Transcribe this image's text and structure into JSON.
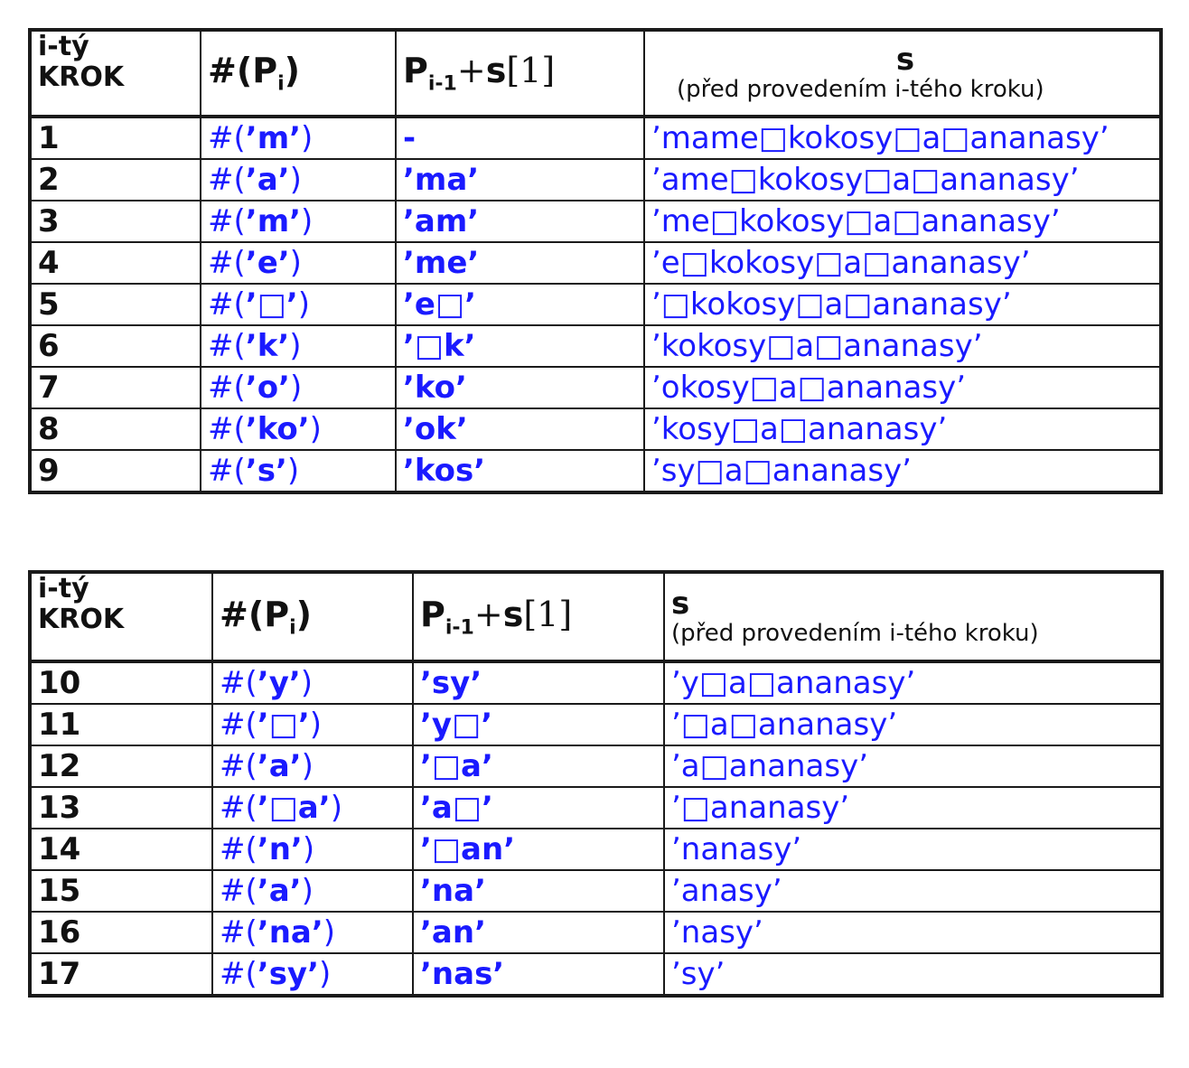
{
  "headers": {
    "step": [
      "i-tý",
      "KROK"
    ],
    "code": {
      "prefix": "#(",
      "p": "P",
      "sub": "i",
      "suffix": ")"
    },
    "prev": {
      "p": "P",
      "sub": "i-1",
      "plus": "+",
      "s": "s",
      "idx": "[1]"
    },
    "s": {
      "letter": "s",
      "note": "(před provedením i-tého kroku)"
    }
  },
  "table1": [
    {
      "step": "1",
      "code": "m",
      "prev": "-",
      "s": "’mame□kokosy□a□ananasy’"
    },
    {
      "step": "2",
      "code": "a",
      "prev": "’ma’",
      "s": "’ame□kokosy□a□ananasy’"
    },
    {
      "step": "3",
      "code": "m",
      "prev": "’am’",
      "s": "’me□kokosy□a□ananasy’"
    },
    {
      "step": "4",
      "code": "e",
      "prev": "’me’",
      "s": "’e□kokosy□a□ananasy’"
    },
    {
      "step": "5",
      "code": "□",
      "prev": "’e□’",
      "s": "’□kokosy□a□ananasy’"
    },
    {
      "step": "6",
      "code": "k",
      "prev": "’□k’",
      "s": "’kokosy□a□ananasy’"
    },
    {
      "step": "7",
      "code": "o",
      "prev": "’ko’",
      "s": "’okosy□a□ananasy’"
    },
    {
      "step": "8",
      "code": "ko",
      "prev": "’ok’",
      "s": "’kosy□a□ananasy’"
    },
    {
      "step": "9",
      "code": "s",
      "prev": "’kos’",
      "s": "’sy□a□ananasy’"
    }
  ],
  "table2": [
    {
      "step": "10",
      "code": "y",
      "prev": "’sy’",
      "s": "’y□a□ananasy’"
    },
    {
      "step": "11",
      "code": "□",
      "prev": "’y□’",
      "s": "’□a□ananasy’"
    },
    {
      "step": "12",
      "code": "a",
      "prev": "’□a’",
      "s": "’a□ananasy’"
    },
    {
      "step": "13",
      "code": "□a",
      "prev": "’a□’",
      "s": "’□ananasy’"
    },
    {
      "step": "14",
      "code": "n",
      "prev": "’□an’",
      "s": "’nanasy’"
    },
    {
      "step": "15",
      "code": "a",
      "prev": "’na’",
      "s": "’anasy’"
    },
    {
      "step": "16",
      "code": "na",
      "prev": "’an’",
      "s": "’nasy’"
    },
    {
      "step": "17",
      "code": "sy",
      "prev": "’nas’",
      "s": "’sy’"
    }
  ]
}
